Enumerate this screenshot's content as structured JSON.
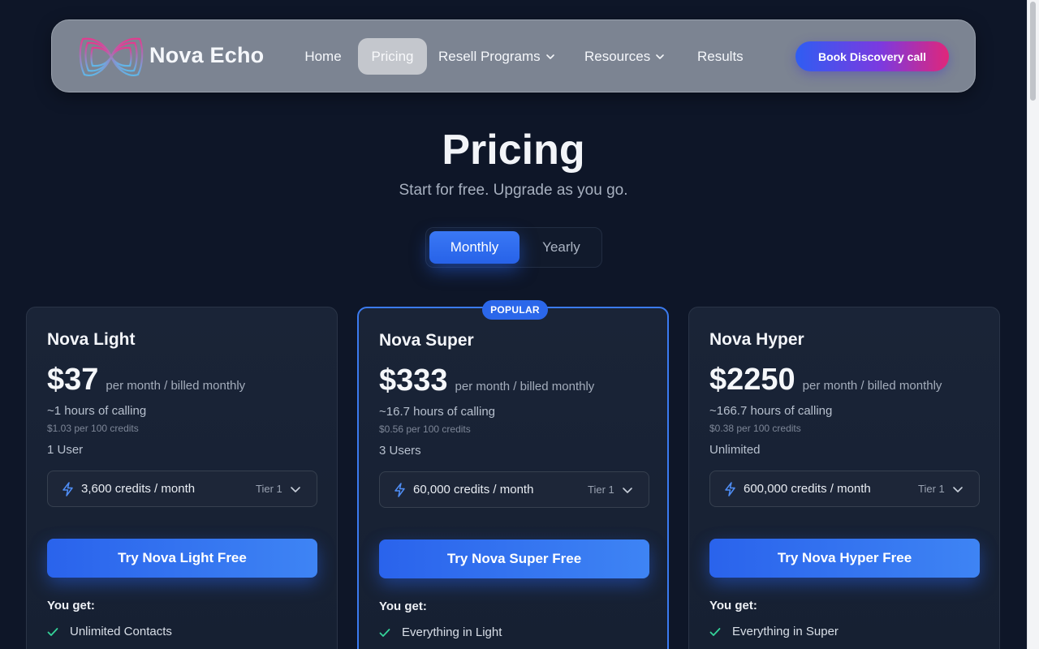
{
  "nav": {
    "brand": "Nova Echo",
    "items": [
      {
        "label": "Home"
      },
      {
        "label": "Pricing",
        "active": true
      },
      {
        "label": "Resell Programs",
        "icon": "chevron-down-icon"
      },
      {
        "label": "Resources",
        "icon": "chevron-down-icon"
      },
      {
        "label": "Results"
      }
    ],
    "cta_label": "Book Discovery call"
  },
  "hero": {
    "title": "Pricing",
    "subtitle": "Start for free. Upgrade as you go."
  },
  "billing_toggle": {
    "options": [
      "Monthly",
      "Yearly"
    ],
    "selected": "Monthly"
  },
  "plans": [
    {
      "name": "Nova Light",
      "price": "$37",
      "period": "per month / billed monthly",
      "hours": "~1 hours of calling",
      "rate": "$1.03 per 100 credits",
      "users": "1 User",
      "credits": "3,600 credits / month",
      "tier": "Tier 1",
      "cta": "Try Nova Light Free",
      "you_get": "You get:",
      "features": [
        "Unlimited Contacts"
      ]
    },
    {
      "name": "Nova Super",
      "badge": "POPULAR",
      "price": "$333",
      "period": "per month / billed monthly",
      "hours": "~16.7 hours of calling",
      "rate": "$0.56 per 100 credits",
      "users": "3 Users",
      "credits": "60,000 credits / month",
      "tier": "Tier 1",
      "cta": "Try Nova Super Free",
      "you_get": "You get:",
      "features": [
        "Everything in Light"
      ]
    },
    {
      "name": "Nova Hyper",
      "price": "$2250",
      "period": "per month / billed monthly",
      "hours": "~166.7 hours of calling",
      "rate": "$0.38 per 100 credits",
      "users": "Unlimited",
      "credits": "600,000 credits / month",
      "tier": "Tier 1",
      "cta": "Try Nova Hyper Free",
      "you_get": "You get:",
      "features": [
        "Everything in Super"
      ]
    }
  ],
  "colors": {
    "background": "#0e1628",
    "accent": "#2b67ea",
    "check": "#34d399",
    "cta_gradient": [
      "#2f5df2",
      "#7b3ae0",
      "#e0267a"
    ]
  }
}
